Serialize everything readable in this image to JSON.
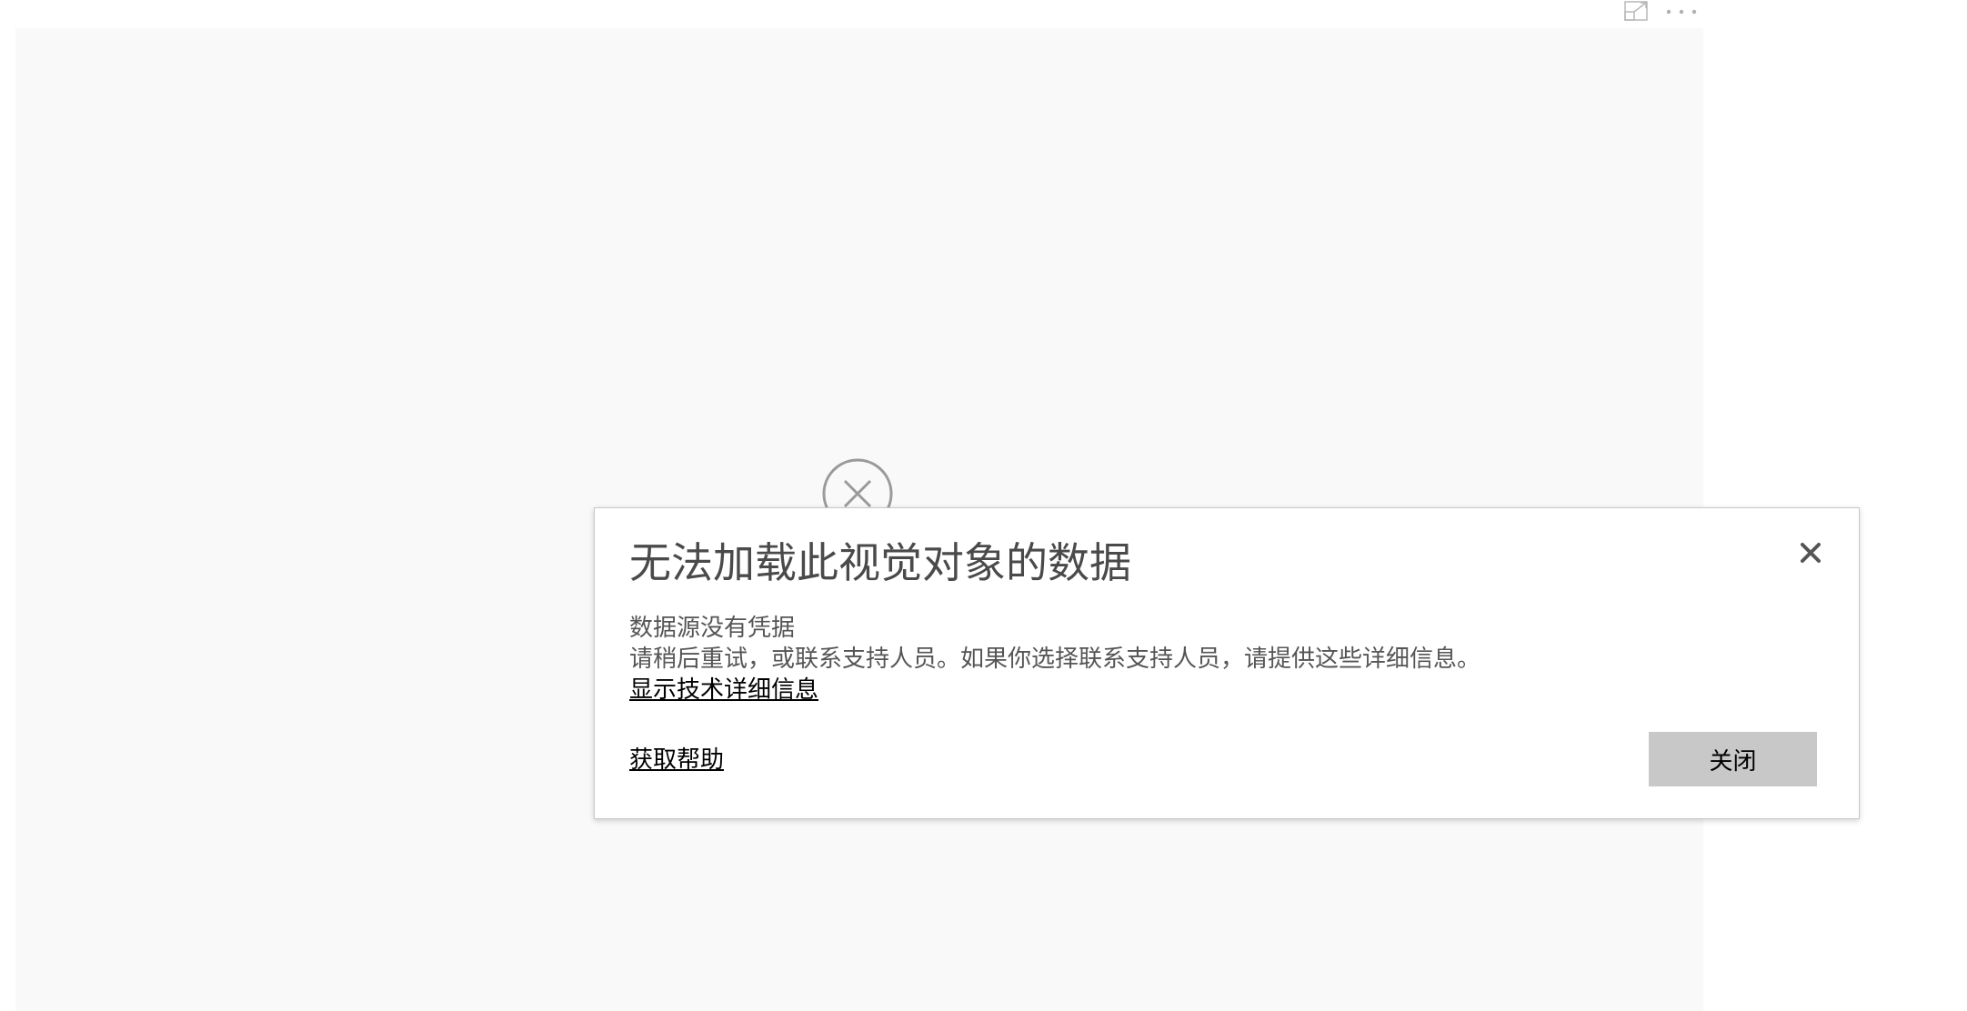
{
  "visual": {
    "header_icons": [
      "focus-mode-icon",
      "more-options-icon"
    ],
    "background_icon": "error-circle-icon"
  },
  "dialog": {
    "title": "无法加载此视觉对象的数据",
    "subtitle": "数据源没有凭据",
    "message": "请稍后重试，或联系支持人员。如果你选择联系支持人员，请提供这些详细信息。",
    "details_link": "显示技术详细信息",
    "help_link": "获取帮助",
    "close_button": "关闭",
    "close_icon": "close-icon"
  },
  "colors": {
    "canvas_background": "#f9f9f9",
    "dialog_background": "#ffffff",
    "button_background": "#c8c8c8",
    "title_color": "#4a4a4a",
    "text_color": "#555555"
  }
}
